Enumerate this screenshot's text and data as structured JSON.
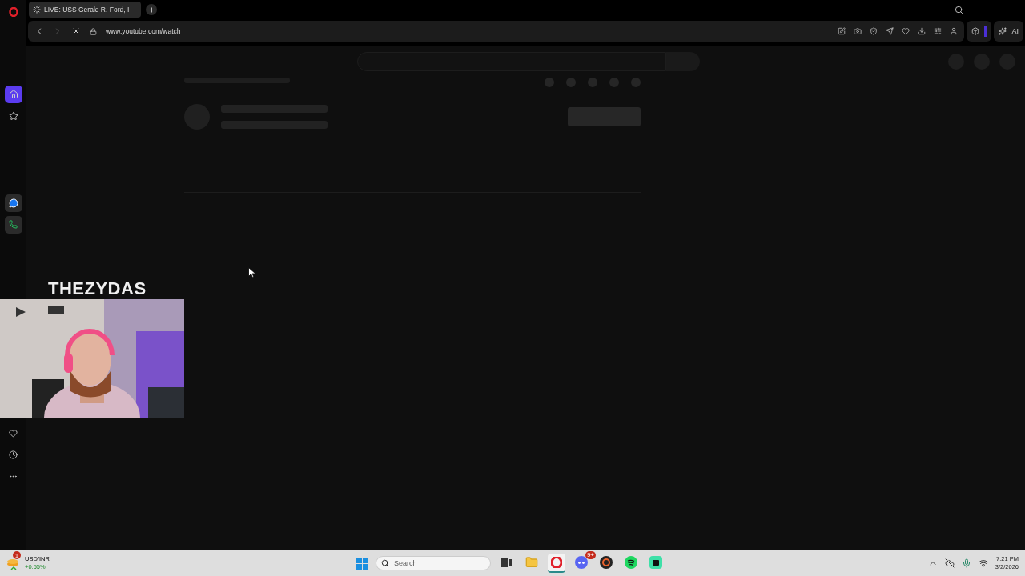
{
  "browser": {
    "tab": {
      "title": "LIVE: USS Gerald R. Ford, I",
      "loading": true
    },
    "address": "www.youtube.com/watch",
    "loading": true,
    "ai_button": "AI"
  },
  "overlay": {
    "streamer_name": "THEZYDAS"
  },
  "taskbar": {
    "widget": {
      "label": "USD/INR",
      "change": "+0.55%",
      "badge": "1"
    },
    "search": {
      "placeholder": "Search"
    },
    "apps": [
      {
        "kind": "taskview",
        "selected": false
      },
      {
        "kind": "folder",
        "selected": false
      },
      {
        "kind": "opera",
        "selected": true
      },
      {
        "kind": "discord",
        "selected": false,
        "badge": "9+"
      },
      {
        "kind": "obs",
        "selected": false
      },
      {
        "kind": "spotify",
        "selected": false
      },
      {
        "kind": "app",
        "selected": false
      }
    ],
    "clock": {
      "time": "7:21 PM",
      "date": "3/2/2026"
    }
  }
}
